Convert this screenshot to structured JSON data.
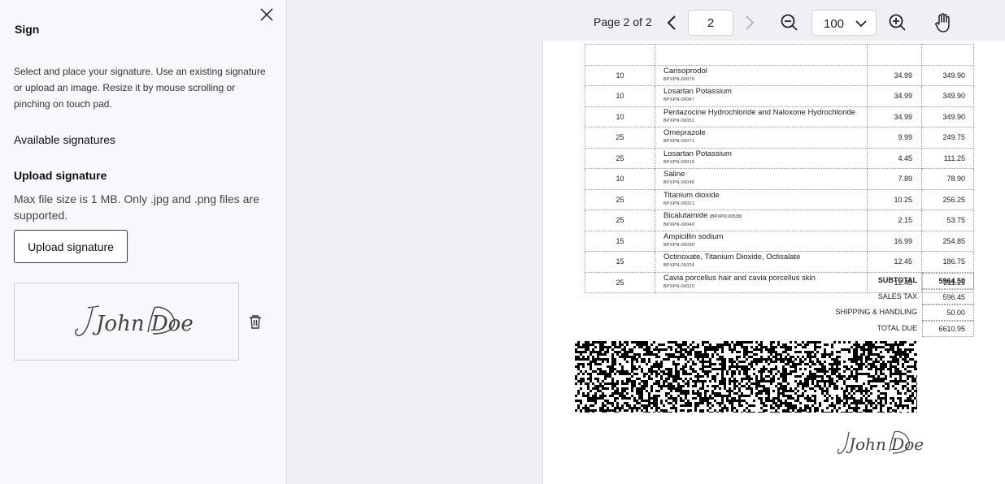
{
  "sidebar": {
    "title": "Sign",
    "instructions": "Select and place your signature. Use an existing signature or upload an image. Resize it by mouse scrolling or pinching on touch pad.",
    "available_heading": "Available signatures",
    "upload_heading": "Upload signature",
    "upload_note": "Max file size is 1 MB. Only .jpg and .png files are supported.",
    "upload_button": "Upload signature",
    "signature_text": "John Doe"
  },
  "toolbar": {
    "page_label": "Page 2 of 2",
    "page_value": "2",
    "zoom_value": "100"
  },
  "document": {
    "items": [
      {
        "qty": "10",
        "name": "Carisoprodol",
        "sku": "BPXPN-00070",
        "price": "34.99",
        "amount": "349.90"
      },
      {
        "qty": "10",
        "name": "Losartan Potassium",
        "sku": "BPXPN-00047",
        "price": "34.99",
        "amount": "349.90"
      },
      {
        "qty": "10",
        "name": "Pentazocine Hydrochloride and Naloxone Hydrochloride",
        "sku": "BPXPN-00051",
        "price": "34.99",
        "amount": "349.90"
      },
      {
        "qty": "25",
        "name": "Omeprazole",
        "sku": "BPXPN-00071",
        "price": "9.99",
        "amount": "249.75"
      },
      {
        "qty": "25",
        "name": "Losartan Potassium",
        "sku": "BPXPN-00019",
        "price": "4.45",
        "amount": "111.25"
      },
      {
        "qty": "10",
        "name": "Saline",
        "sku": "BPXPN-00048",
        "price": "7.89",
        "amount": "78.90"
      },
      {
        "qty": "25",
        "name": "Titanium dioxide",
        "sku": "BPXPN-00021",
        "price": "10.25",
        "amount": "256.25"
      },
      {
        "qty": "25",
        "name": "Bicalutamide",
        "inline_sku": "(BPXPO.00538)",
        "sku": "BPXPN-00049",
        "price": "2.15",
        "amount": "53.75"
      },
      {
        "qty": "15",
        "name": "Ampicillin sodium",
        "sku": "BPXPN-00050",
        "price": "16.99",
        "amount": "254.85"
      },
      {
        "qty": "15",
        "name": "Octinoxate, Titanium Dioxide, Octisalate",
        "sku": "BPXPN-00024",
        "price": "12.45",
        "amount": "186.75"
      },
      {
        "qty": "25",
        "name": "Cavia porcellus hair and cavia porcellus skin",
        "sku": "BPXPN-00020",
        "price": "12.45",
        "amount": "311.25"
      }
    ],
    "totals": {
      "subtotal_label": "SUBTOTAL",
      "subtotal": "5964.50",
      "tax_label": "SALES TAX",
      "tax": "596.45",
      "shipping_label": "SHIPPING & HANDLING",
      "shipping": "50.00",
      "total_label": "TOTAL DUE",
      "total": "6610.95"
    },
    "signature_text": "John Doe"
  }
}
